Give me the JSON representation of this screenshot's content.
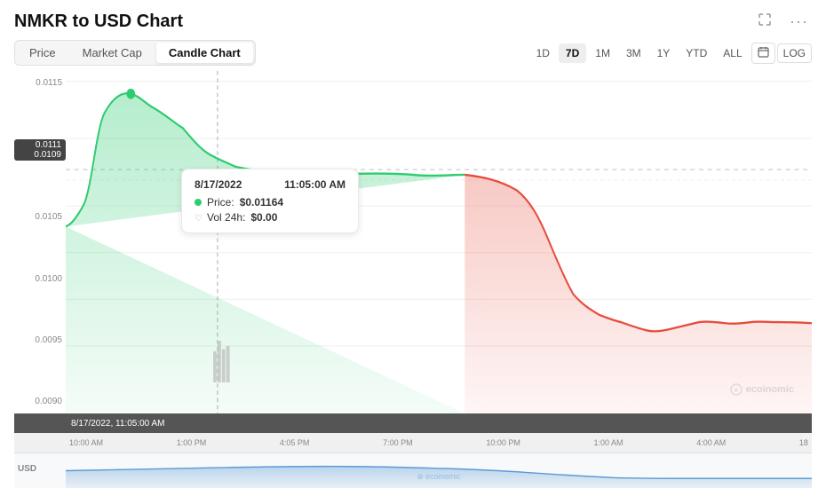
{
  "header": {
    "title": "NMKR to USD Chart",
    "expand_icon": "⛶",
    "more_icon": "···"
  },
  "tabs": {
    "left": [
      {
        "label": "Price",
        "active": false
      },
      {
        "label": "Market Cap",
        "active": false
      },
      {
        "label": "Candle Chart",
        "active": true
      }
    ],
    "right": [
      {
        "label": "1D",
        "active": false
      },
      {
        "label": "7D",
        "active": true
      },
      {
        "label": "1M",
        "active": false
      },
      {
        "label": "3M",
        "active": false
      },
      {
        "label": "1Y",
        "active": false
      },
      {
        "label": "YTD",
        "active": false
      },
      {
        "label": "ALL",
        "active": false
      },
      {
        "label": "📅",
        "active": false,
        "special": true
      },
      {
        "label": "LOG",
        "active": false,
        "special": true
      }
    ]
  },
  "y_axis": {
    "labels": [
      "0.0115",
      "0.0111",
      "0.0109",
      "0.0105",
      "0.0100",
      "0.0095",
      "0.0090"
    ]
  },
  "x_axis": {
    "highlight_label": "8/17/2022, 11:05:00 AM",
    "labels": [
      "10:00 AM",
      "1:00 PM",
      "4:05 PM",
      "7:00 PM",
      "10:00 PM",
      "1:00 AM",
      "4:00 AM",
      "18"
    ]
  },
  "tooltip": {
    "date": "8/17/2022",
    "time": "11:05:00 AM",
    "price_label": "Price:",
    "price_value": "$0.01164",
    "vol_label": "Vol 24h:",
    "vol_value": "$0.00"
  },
  "watermark": {
    "text": "ecoinomic"
  },
  "usd_label": "USD"
}
